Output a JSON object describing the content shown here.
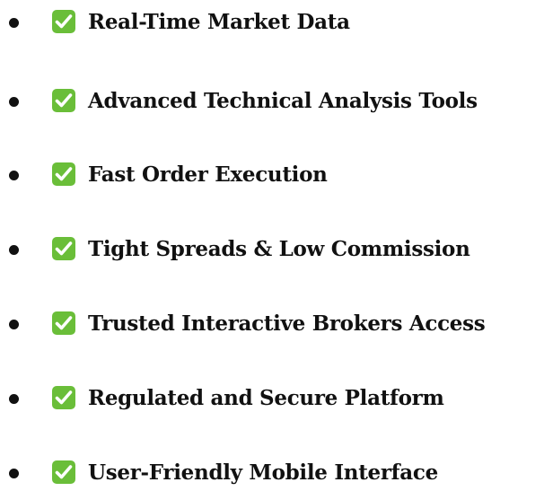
{
  "icons": {
    "bullet": "bullet-dot",
    "check": "white-check-mark-green-box"
  },
  "colors": {
    "check_box": "#6ABE39",
    "check_mark": "#ffffff",
    "text": "#111111"
  },
  "features": [
    {
      "label": "Real-Time Market Data"
    },
    {
      "label": "Advanced Technical Analysis Tools"
    },
    {
      "label": "Fast Order Execution"
    },
    {
      "label": "Tight Spreads & Low Commission"
    },
    {
      "label": "Trusted Interactive Brokers Access"
    },
    {
      "label": "Regulated and Secure Platform"
    },
    {
      "label": "User-Friendly Mobile Interface"
    }
  ]
}
